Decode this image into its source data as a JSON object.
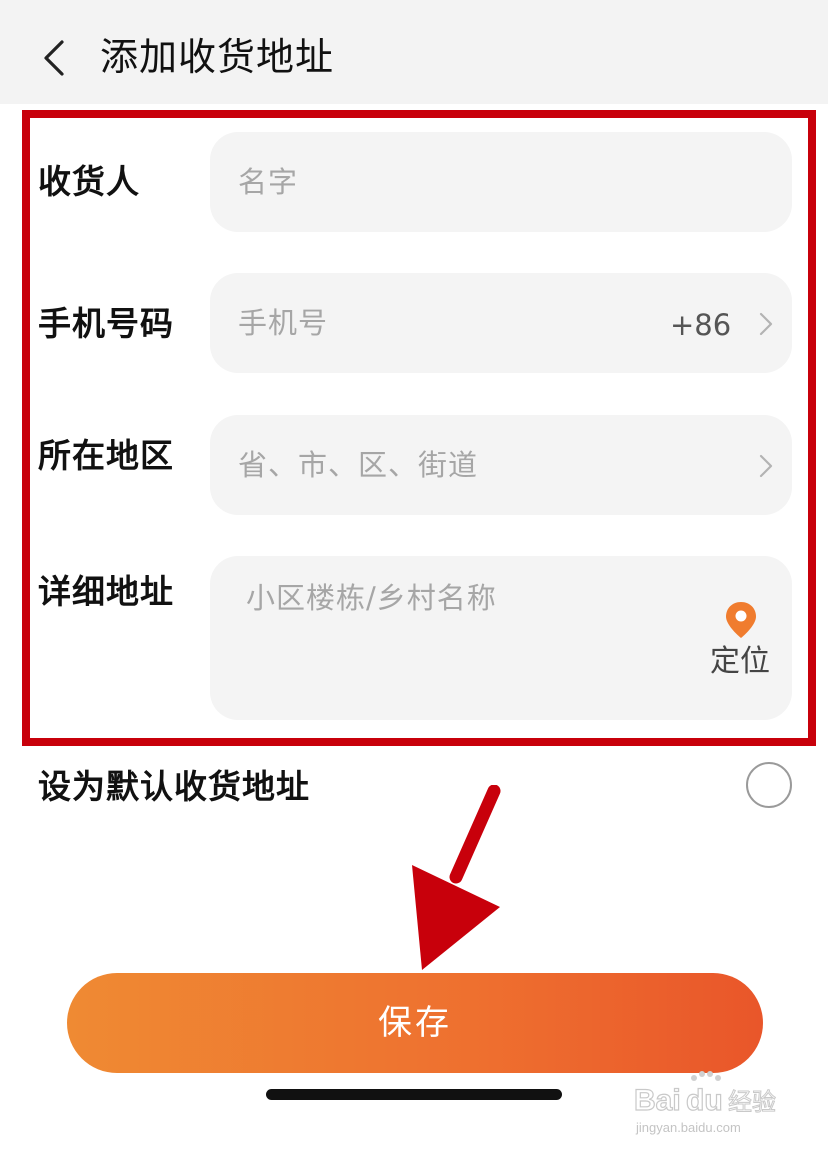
{
  "header": {
    "title": "添加收货地址"
  },
  "form": {
    "recipient": {
      "label": "收货人",
      "placeholder": "名字"
    },
    "phone": {
      "label": "手机号码",
      "placeholder": "手机号",
      "country_code": "+86"
    },
    "region": {
      "label": "所在地区",
      "placeholder": "省、市、区、街道"
    },
    "address": {
      "label": "详细地址",
      "placeholder": "小区楼栋/乡村名称",
      "locate_label": "定位"
    }
  },
  "default_option": {
    "label": "设为默认收货地址",
    "checked": false
  },
  "save": {
    "label": "保存"
  },
  "colors": {
    "annotation_red": "#c8000b",
    "locate_orange": "#f07c2e",
    "save_gradient_start": "#ef8a33",
    "save_gradient_end": "#e9562a"
  },
  "watermark": {
    "brand": "Bai",
    "brand_suffix": "du",
    "product": "经验",
    "url": "jingyan.baidu.com"
  }
}
